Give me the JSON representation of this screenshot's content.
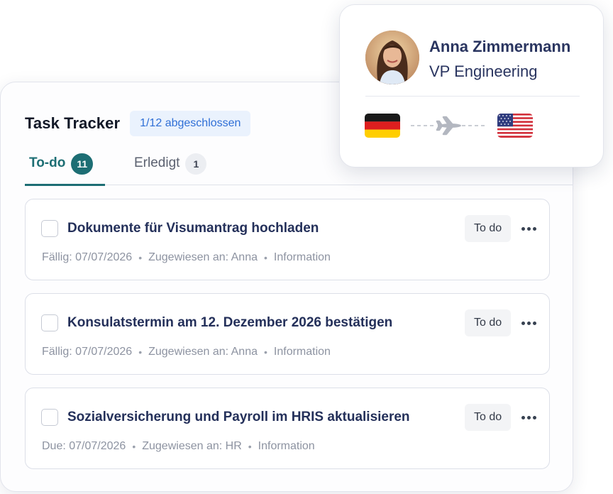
{
  "tracker": {
    "title": "Task Tracker",
    "progress": "1/12 abgeschlossen",
    "tabs": [
      {
        "label": "To-do",
        "count": "11",
        "active": true
      },
      {
        "label": "Erledigt",
        "count": "1",
        "active": false
      }
    ],
    "tasks": [
      {
        "title": "Dokumente für Visumantrag hochladen",
        "due": "Fällig: 07/07/2026",
        "assignee": "Zugewiesen an: Anna",
        "category": "Information",
        "status": "To do"
      },
      {
        "title": "Konsulatstermin am 12. Dezember 2026 bestätigen",
        "due": "Fällig: 07/07/2026",
        "assignee": "Zugewiesen an: Anna",
        "category": "Information",
        "status": "To do"
      },
      {
        "title": "Sozialversicherung und Payroll im HRIS aktualisieren",
        "due": "Due: 07/07/2026",
        "assignee": "Zugewiesen an: HR",
        "category": "Information",
        "status": "To do"
      }
    ],
    "separator": "•"
  },
  "profile": {
    "name": "Anna Zimmermann",
    "role": "VP Engineering",
    "origin_flag": "germany-flag-icon",
    "destination_flag": "usa-flag-icon",
    "route_icon": "airplane-icon"
  },
  "colors": {
    "accent": "#1d6e74",
    "title_text": "#24305a",
    "badge_bg": "#eaf2fd",
    "badge_text": "#2f6fd6"
  }
}
